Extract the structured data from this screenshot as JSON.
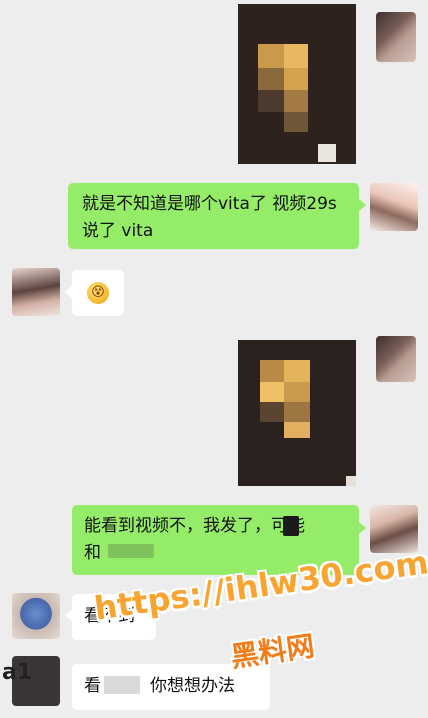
{
  "messages": {
    "m1_text": "就是不知道是哪个vita了 视频29s说了 vita",
    "m3_text": "能看到视频不，我发了，可能",
    "m3_text_line2": "和",
    "m4_text": "看不到",
    "m5_text": "你想想办法",
    "m5_partial": "看"
  },
  "emoji": {
    "reply_emoji": "😵"
  },
  "bottom_left_label": "a1",
  "watermark": {
    "url": "https://ihlw30.com",
    "name": "黑料网"
  },
  "colors": {
    "chat_background": "#ededed",
    "sent_bubble": "#95ec69",
    "received_bubble": "#ffffff",
    "watermark_orange": "#f9a430"
  }
}
